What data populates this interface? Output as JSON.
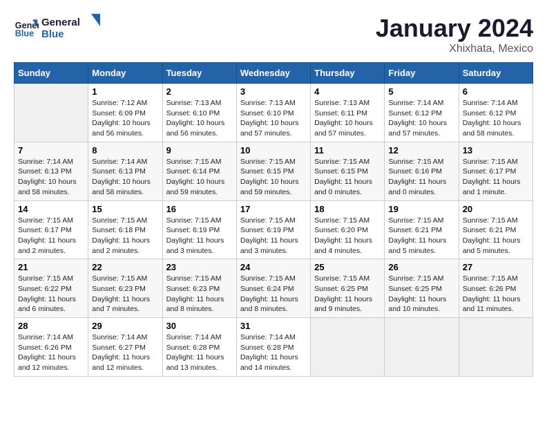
{
  "logo": {
    "line1": "General",
    "line2": "Blue"
  },
  "title": "January 2024",
  "subtitle": "Xhixhata, Mexico",
  "weekdays": [
    "Sunday",
    "Monday",
    "Tuesday",
    "Wednesday",
    "Thursday",
    "Friday",
    "Saturday"
  ],
  "weeks": [
    [
      {
        "day": null
      },
      {
        "day": "1",
        "sunrise": "7:12 AM",
        "sunset": "6:09 PM",
        "daylight": "10 hours and 56 minutes."
      },
      {
        "day": "2",
        "sunrise": "7:13 AM",
        "sunset": "6:10 PM",
        "daylight": "10 hours and 56 minutes."
      },
      {
        "day": "3",
        "sunrise": "7:13 AM",
        "sunset": "6:10 PM",
        "daylight": "10 hours and 57 minutes."
      },
      {
        "day": "4",
        "sunrise": "7:13 AM",
        "sunset": "6:11 PM",
        "daylight": "10 hours and 57 minutes."
      },
      {
        "day": "5",
        "sunrise": "7:14 AM",
        "sunset": "6:12 PM",
        "daylight": "10 hours and 57 minutes."
      },
      {
        "day": "6",
        "sunrise": "7:14 AM",
        "sunset": "6:12 PM",
        "daylight": "10 hours and 58 minutes."
      }
    ],
    [
      {
        "day": "7",
        "sunrise": "7:14 AM",
        "sunset": "6:13 PM",
        "daylight": "10 hours and 58 minutes."
      },
      {
        "day": "8",
        "sunrise": "7:14 AM",
        "sunset": "6:13 PM",
        "daylight": "10 hours and 58 minutes."
      },
      {
        "day": "9",
        "sunrise": "7:15 AM",
        "sunset": "6:14 PM",
        "daylight": "10 hours and 59 minutes."
      },
      {
        "day": "10",
        "sunrise": "7:15 AM",
        "sunset": "6:15 PM",
        "daylight": "10 hours and 59 minutes."
      },
      {
        "day": "11",
        "sunrise": "7:15 AM",
        "sunset": "6:15 PM",
        "daylight": "11 hours and 0 minutes."
      },
      {
        "day": "12",
        "sunrise": "7:15 AM",
        "sunset": "6:16 PM",
        "daylight": "11 hours and 0 minutes."
      },
      {
        "day": "13",
        "sunrise": "7:15 AM",
        "sunset": "6:17 PM",
        "daylight": "11 hours and 1 minute."
      }
    ],
    [
      {
        "day": "14",
        "sunrise": "7:15 AM",
        "sunset": "6:17 PM",
        "daylight": "11 hours and 2 minutes."
      },
      {
        "day": "15",
        "sunrise": "7:15 AM",
        "sunset": "6:18 PM",
        "daylight": "11 hours and 2 minutes."
      },
      {
        "day": "16",
        "sunrise": "7:15 AM",
        "sunset": "6:19 PM",
        "daylight": "11 hours and 3 minutes."
      },
      {
        "day": "17",
        "sunrise": "7:15 AM",
        "sunset": "6:19 PM",
        "daylight": "11 hours and 3 minutes."
      },
      {
        "day": "18",
        "sunrise": "7:15 AM",
        "sunset": "6:20 PM",
        "daylight": "11 hours and 4 minutes."
      },
      {
        "day": "19",
        "sunrise": "7:15 AM",
        "sunset": "6:21 PM",
        "daylight": "11 hours and 5 minutes."
      },
      {
        "day": "20",
        "sunrise": "7:15 AM",
        "sunset": "6:21 PM",
        "daylight": "11 hours and 5 minutes."
      }
    ],
    [
      {
        "day": "21",
        "sunrise": "7:15 AM",
        "sunset": "6:22 PM",
        "daylight": "11 hours and 6 minutes."
      },
      {
        "day": "22",
        "sunrise": "7:15 AM",
        "sunset": "6:23 PM",
        "daylight": "11 hours and 7 minutes."
      },
      {
        "day": "23",
        "sunrise": "7:15 AM",
        "sunset": "6:23 PM",
        "daylight": "11 hours and 8 minutes."
      },
      {
        "day": "24",
        "sunrise": "7:15 AM",
        "sunset": "6:24 PM",
        "daylight": "11 hours and 8 minutes."
      },
      {
        "day": "25",
        "sunrise": "7:15 AM",
        "sunset": "6:25 PM",
        "daylight": "11 hours and 9 minutes."
      },
      {
        "day": "26",
        "sunrise": "7:15 AM",
        "sunset": "6:25 PM",
        "daylight": "11 hours and 10 minutes."
      },
      {
        "day": "27",
        "sunrise": "7:15 AM",
        "sunset": "6:26 PM",
        "daylight": "11 hours and 11 minutes."
      }
    ],
    [
      {
        "day": "28",
        "sunrise": "7:14 AM",
        "sunset": "6:26 PM",
        "daylight": "11 hours and 12 minutes."
      },
      {
        "day": "29",
        "sunrise": "7:14 AM",
        "sunset": "6:27 PM",
        "daylight": "11 hours and 12 minutes."
      },
      {
        "day": "30",
        "sunrise": "7:14 AM",
        "sunset": "6:28 PM",
        "daylight": "11 hours and 13 minutes."
      },
      {
        "day": "31",
        "sunrise": "7:14 AM",
        "sunset": "6:28 PM",
        "daylight": "11 hours and 14 minutes."
      },
      {
        "day": null
      },
      {
        "day": null
      },
      {
        "day": null
      }
    ]
  ],
  "labels": {
    "sunrise_prefix": "Sunrise:",
    "sunset_prefix": "Sunset:",
    "daylight_prefix": "Daylight:"
  }
}
